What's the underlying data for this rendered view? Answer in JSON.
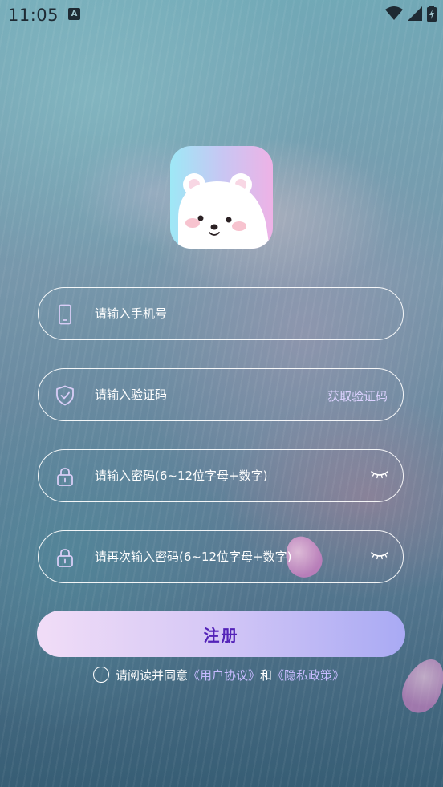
{
  "status_bar": {
    "time": "11:05",
    "notification_icon": "A",
    "icons": [
      "wifi-icon",
      "signal-icon",
      "battery-charging-icon"
    ]
  },
  "logo": {
    "icon": "polar-bear-app-icon"
  },
  "form": {
    "phone": {
      "placeholder": "请输入手机号",
      "icon": "phone-icon"
    },
    "code": {
      "placeholder": "请输入验证码",
      "icon": "shield-check-icon",
      "action_label": "获取验证码"
    },
    "password": {
      "placeholder": "请输入密码(6~12位字母+数字)",
      "icon": "lock-icon",
      "toggle_icon": "eye-closed-icon"
    },
    "password_confirm": {
      "placeholder": "请再次输入密码(6~12位字母+数字)",
      "icon": "lock-icon",
      "toggle_icon": "eye-closed-icon"
    },
    "submit_label": "注册"
  },
  "agreement": {
    "prefix": "请阅读并同意",
    "terms_link": "《用户协议》",
    "and_text": "和",
    "privacy_link": "《隐私政策》",
    "checked": false
  },
  "colors": {
    "accent_text": "#5322b8",
    "link": "#c7bbff",
    "button_gradient_start": "#f1ddf7",
    "button_gradient_end": "#a9aaf4"
  }
}
